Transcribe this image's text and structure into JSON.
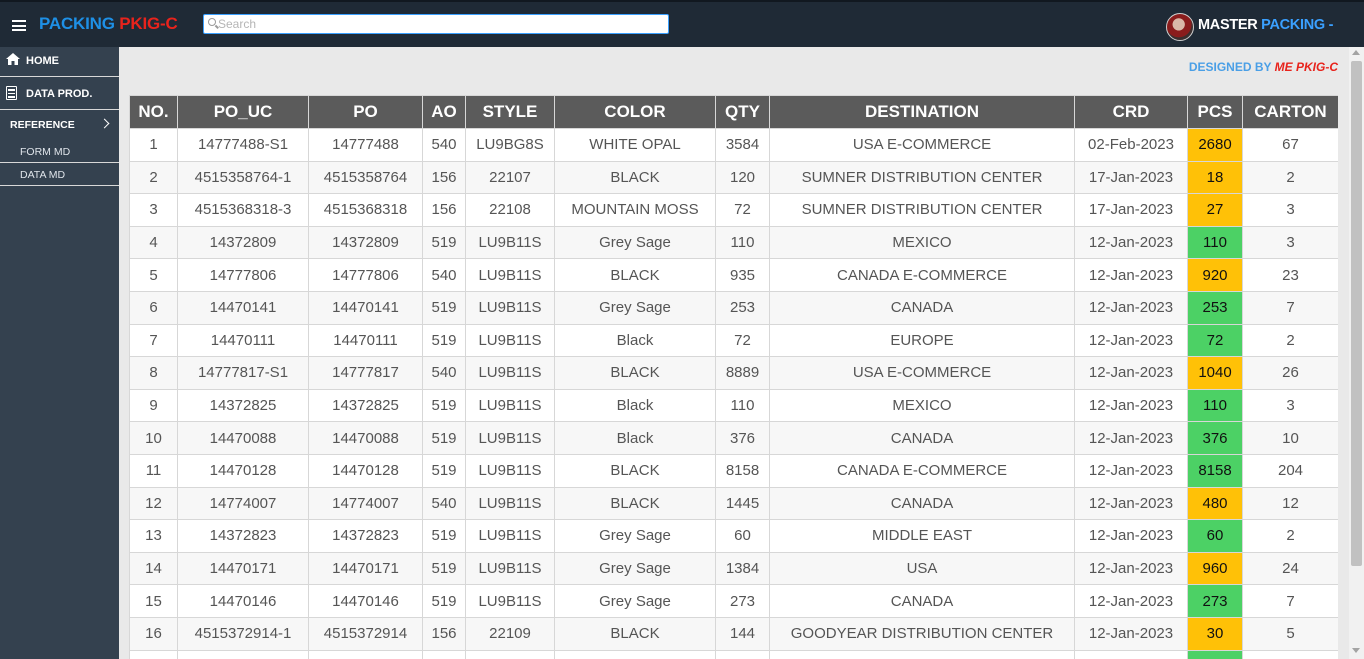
{
  "header": {
    "brand_part1": "PACKING",
    "brand_part2": "PKIG-C",
    "search_placeholder": "Search",
    "user_part1": "MASTER",
    "user_part2": "PACKING",
    "user_caret": "-"
  },
  "sidebar": {
    "home": "HOME",
    "data_prod": "DATA PROD.",
    "reference": "REFERENCE",
    "form_md": "FORM MD",
    "data_md": "DATA MD"
  },
  "designed_by": {
    "prefix": "DESIGNED BY",
    "name": "ME PKIG-C"
  },
  "colors": {
    "pcs_orange": "#ffc107",
    "pcs_green": "#4cd165",
    "header_bg": "#1f2a36",
    "sidebar_bg": "#34414f",
    "table_header_bg": "#5b5b5b"
  },
  "table": {
    "columns": [
      "NO.",
      "PO_UC",
      "PO",
      "AO",
      "STYLE",
      "COLOR",
      "QTY",
      "DESTINATION",
      "CRD",
      "PCS",
      "CARTON"
    ],
    "rows": [
      {
        "no": "1",
        "po_uc": "14777488-S1",
        "po": "14777488",
        "ao": "540",
        "style": "LU9BG8S",
        "color": "WHITE OPAL",
        "qty": "3584",
        "destination": "USA E-COMMERCE",
        "crd": "02-Feb-2023",
        "pcs": "2680",
        "pcs_status": "orange",
        "carton": "67"
      },
      {
        "no": "2",
        "po_uc": "4515358764-1",
        "po": "4515358764",
        "ao": "156",
        "style": "22107",
        "color": "BLACK",
        "qty": "120",
        "destination": "SUMNER DISTRIBUTION CENTER",
        "crd": "17-Jan-2023",
        "pcs": "18",
        "pcs_status": "orange",
        "carton": "2"
      },
      {
        "no": "3",
        "po_uc": "4515368318-3",
        "po": "4515368318",
        "ao": "156",
        "style": "22108",
        "color": "MOUNTAIN MOSS",
        "qty": "72",
        "destination": "SUMNER DISTRIBUTION CENTER",
        "crd": "17-Jan-2023",
        "pcs": "27",
        "pcs_status": "orange",
        "carton": "3"
      },
      {
        "no": "4",
        "po_uc": "14372809",
        "po": "14372809",
        "ao": "519",
        "style": "LU9B11S",
        "color": "Grey Sage",
        "qty": "110",
        "destination": "MEXICO",
        "crd": "12-Jan-2023",
        "pcs": "110",
        "pcs_status": "green",
        "carton": "3"
      },
      {
        "no": "5",
        "po_uc": "14777806",
        "po": "14777806",
        "ao": "540",
        "style": "LU9B11S",
        "color": "BLACK",
        "qty": "935",
        "destination": "CANADA E-COMMERCE",
        "crd": "12-Jan-2023",
        "pcs": "920",
        "pcs_status": "orange",
        "carton": "23"
      },
      {
        "no": "6",
        "po_uc": "14470141",
        "po": "14470141",
        "ao": "519",
        "style": "LU9B11S",
        "color": "Grey Sage",
        "qty": "253",
        "destination": "CANADA",
        "crd": "12-Jan-2023",
        "pcs": "253",
        "pcs_status": "green",
        "carton": "7"
      },
      {
        "no": "7",
        "po_uc": "14470111",
        "po": "14470111",
        "ao": "519",
        "style": "LU9B11S",
        "color": "Black",
        "qty": "72",
        "destination": "EUROPE",
        "crd": "12-Jan-2023",
        "pcs": "72",
        "pcs_status": "green",
        "carton": "2"
      },
      {
        "no": "8",
        "po_uc": "14777817-S1",
        "po": "14777817",
        "ao": "540",
        "style": "LU9B11S",
        "color": "BLACK",
        "qty": "8889",
        "destination": "USA E-COMMERCE",
        "crd": "12-Jan-2023",
        "pcs": "1040",
        "pcs_status": "orange",
        "carton": "26"
      },
      {
        "no": "9",
        "po_uc": "14372825",
        "po": "14372825",
        "ao": "519",
        "style": "LU9B11S",
        "color": "Black",
        "qty": "110",
        "destination": "MEXICO",
        "crd": "12-Jan-2023",
        "pcs": "110",
        "pcs_status": "green",
        "carton": "3"
      },
      {
        "no": "10",
        "po_uc": "14470088",
        "po": "14470088",
        "ao": "519",
        "style": "LU9B11S",
        "color": "Black",
        "qty": "376",
        "destination": "CANADA",
        "crd": "12-Jan-2023",
        "pcs": "376",
        "pcs_status": "green",
        "carton": "10"
      },
      {
        "no": "11",
        "po_uc": "14470128",
        "po": "14470128",
        "ao": "519",
        "style": "LU9B11S",
        "color": "BLACK",
        "qty": "8158",
        "destination": "CANADA E-COMMERCE",
        "crd": "12-Jan-2023",
        "pcs": "8158",
        "pcs_status": "green",
        "carton": "204"
      },
      {
        "no": "12",
        "po_uc": "14774007",
        "po": "14774007",
        "ao": "540",
        "style": "LU9B11S",
        "color": "BLACK",
        "qty": "1445",
        "destination": "CANADA",
        "crd": "12-Jan-2023",
        "pcs": "480",
        "pcs_status": "orange",
        "carton": "12"
      },
      {
        "no": "13",
        "po_uc": "14372823",
        "po": "14372823",
        "ao": "519",
        "style": "LU9B11S",
        "color": "Grey Sage",
        "qty": "60",
        "destination": "MIDDLE EAST",
        "crd": "12-Jan-2023",
        "pcs": "60",
        "pcs_status": "green",
        "carton": "2"
      },
      {
        "no": "14",
        "po_uc": "14470171",
        "po": "14470171",
        "ao": "519",
        "style": "LU9B11S",
        "color": "Grey Sage",
        "qty": "1384",
        "destination": "USA",
        "crd": "12-Jan-2023",
        "pcs": "960",
        "pcs_status": "orange",
        "carton": "24"
      },
      {
        "no": "15",
        "po_uc": "14470146",
        "po": "14470146",
        "ao": "519",
        "style": "LU9B11S",
        "color": "Grey Sage",
        "qty": "273",
        "destination": "CANADA",
        "crd": "12-Jan-2023",
        "pcs": "273",
        "pcs_status": "green",
        "carton": "7"
      },
      {
        "no": "16",
        "po_uc": "4515372914-1",
        "po": "4515372914",
        "ao": "156",
        "style": "22109",
        "color": "BLACK",
        "qty": "144",
        "destination": "GOODYEAR DISTRIBUTION CENTER",
        "crd": "12-Jan-2023",
        "pcs": "30",
        "pcs_status": "orange",
        "carton": "5"
      },
      {
        "no": "",
        "po_uc": "",
        "po": "",
        "ao": "",
        "style": "",
        "color": "",
        "qty": "",
        "destination": "",
        "crd": "",
        "pcs": "",
        "pcs_status": "green",
        "carton": ""
      }
    ]
  }
}
